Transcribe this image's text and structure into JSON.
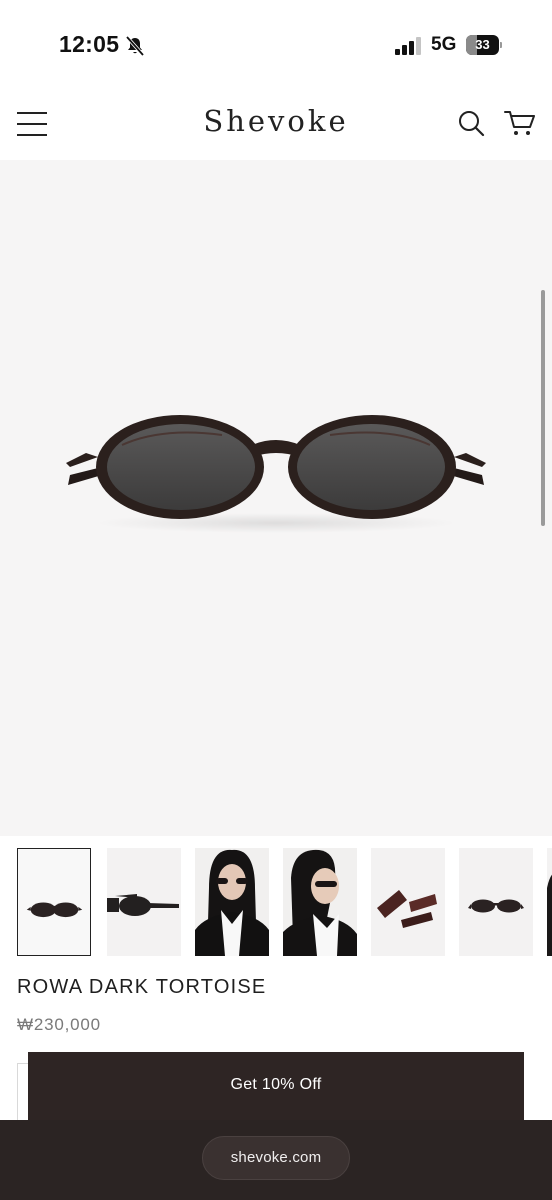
{
  "status_bar": {
    "time": "12:05",
    "network": "5G",
    "battery_level": "33",
    "battery_fraction": 0.33,
    "icons": [
      "bell-muted-icon",
      "signal-icon",
      "battery-icon"
    ]
  },
  "header": {
    "brand": "Shevoke",
    "icons": [
      "menu-icon",
      "search-icon",
      "cart-icon"
    ]
  },
  "hero": {
    "image": "sunglasses-front-view",
    "background_color": "#f6f5f5"
  },
  "thumbnails": [
    {
      "image": "sunglasses-front",
      "selected": true
    },
    {
      "image": "sunglasses-side",
      "selected": false
    },
    {
      "image": "model-front",
      "selected": false
    },
    {
      "image": "model-side",
      "selected": false
    },
    {
      "image": "case-packaging",
      "selected": false
    },
    {
      "image": "sunglasses-top",
      "selected": false
    }
  ],
  "product": {
    "name": "ROWA DARK TORTOISE",
    "price": "₩230,000"
  },
  "promo": {
    "label": "Get 10% Off"
  },
  "browser": {
    "domain": "shevoke.com"
  },
  "colors": {
    "promo_bg": "#2e2524",
    "bottom_bar_bg": "#2b2423",
    "accent_text": "#1f1f1f"
  }
}
